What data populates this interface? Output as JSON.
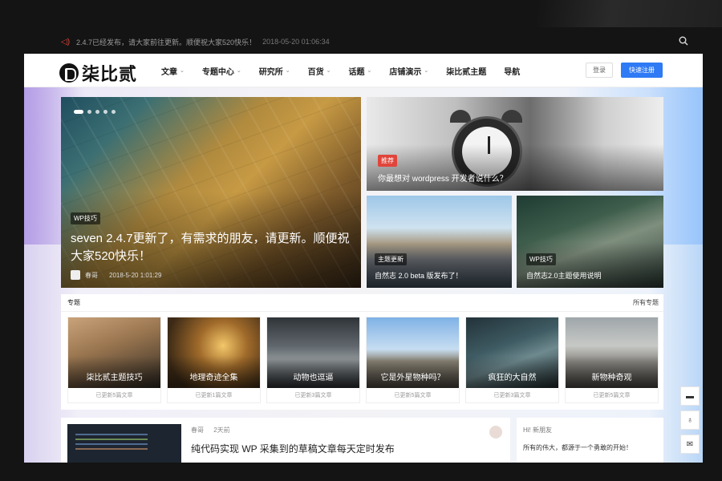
{
  "topbar": {
    "notice": "2.4.7已经发布，请大家前往更新。顺便祝大家520快乐！",
    "time": "2018-05-20 01:06:34"
  },
  "header": {
    "logo_text": "柒比贰",
    "nav": [
      {
        "label": "文章",
        "dropdown": true
      },
      {
        "label": "专题中心",
        "dropdown": true
      },
      {
        "label": "研究所",
        "dropdown": true
      },
      {
        "label": "百货",
        "dropdown": true
      },
      {
        "label": "话题",
        "dropdown": true
      },
      {
        "label": "店铺演示",
        "dropdown": true
      },
      {
        "label": "柒比贰主题",
        "dropdown": false
      },
      {
        "label": "导航",
        "dropdown": false
      }
    ],
    "login_label": "登录",
    "register_label": "快速注册"
  },
  "hero": {
    "main": {
      "badge": "WP技巧",
      "title": "seven 2.4.7更新了，有需求的朋友，请更新。顺便祝大家520快乐！",
      "author": "春哥",
      "date": "2018-5-20 1:01:29"
    },
    "tiles": [
      {
        "badge": "推荐",
        "title": "你最想对 wordpress 开发者说什么？"
      },
      {
        "badge": "主题更新",
        "title": "自然志 2.0 beta 版发布了！"
      },
      {
        "badge": "WP技巧",
        "title": "自然志2.0主题使用说明"
      }
    ]
  },
  "topics": {
    "heading": "专题",
    "all_label": "所有专题",
    "items": [
      {
        "name": "柒比贰主题技巧",
        "count": "已更新5篇文章"
      },
      {
        "name": "地理奇迹全集",
        "count": "已更新1篇文章"
      },
      {
        "name": "动物也逗逼",
        "count": "已更新3篇文章"
      },
      {
        "name": "它是外星物种吗？",
        "count": "已更新5篇文章"
      },
      {
        "name": "疯狂的大自然",
        "count": "已更新3篇文章"
      },
      {
        "name": "新物种奇观",
        "count": "已更新5篇文章"
      }
    ]
  },
  "post": {
    "author": "春哥",
    "ago": "2天前",
    "title": "纯代码实现 WP 采集到的草稿文章每天定时发布"
  },
  "widget": {
    "title": "Hi! 新朋友",
    "body": "所有的伟大，都源于一个勇敢的开始！"
  },
  "colors": {
    "accent": "#2f7af5",
    "badge_red": "#e0453b"
  }
}
